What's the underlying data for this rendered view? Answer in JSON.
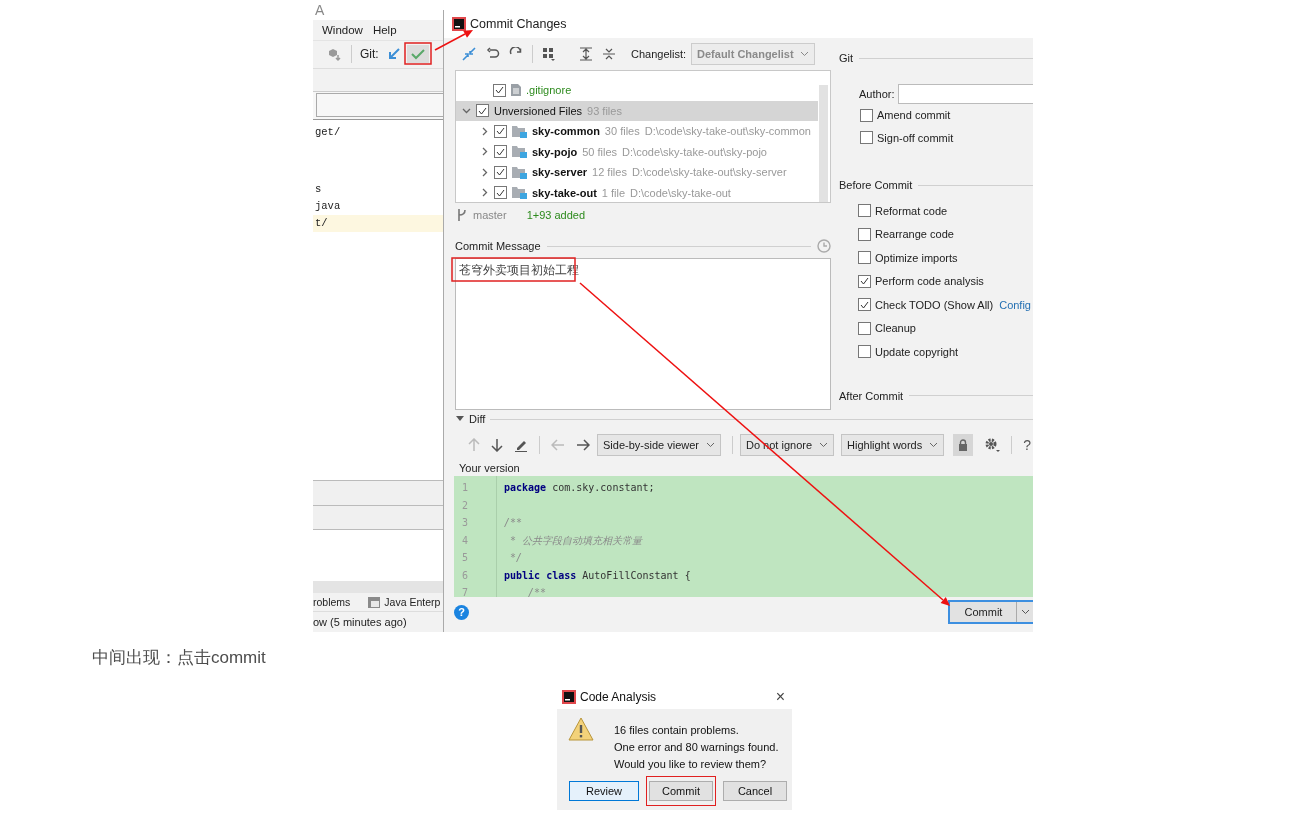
{
  "ide": {
    "title": "A",
    "menu": [
      {
        "label": "Window"
      },
      {
        "label": "Help"
      }
    ],
    "git_label": "Git:",
    "files": [
      {
        "text": "get/",
        "highlighted": false
      },
      {
        "text": "s",
        "highlighted": false
      },
      {
        "text": "java",
        "highlighted": false
      },
      {
        "text": "t/",
        "highlighted": true
      }
    ],
    "tool_tabs": [
      {
        "label": "roblems",
        "kind": "plain"
      },
      {
        "label": "Java Enterp",
        "kind": "icon"
      }
    ],
    "status": "ow (5 minutes ago)"
  },
  "commit_dialog": {
    "title": "Commit Changes",
    "changelist_label": "Changelist:",
    "changelist": {
      "value": "Default Changelist",
      "disabled": true
    },
    "tree": [
      {
        "name": ".gitignore",
        "kind": "file",
        "checked": true,
        "selected": false
      },
      {
        "name": "Unversioned Files",
        "count": "93 files",
        "kind": "group",
        "checked": true,
        "expanded": true,
        "selected": true,
        "children": [
          {
            "name": "sky-common",
            "count": "30 files",
            "path": "D:\\code\\sky-take-out\\sky-common",
            "checked": true,
            "expanded": false,
            "selected": false
          },
          {
            "name": "sky-pojo",
            "count": "50 files",
            "path": "D:\\code\\sky-take-out\\sky-pojo",
            "checked": true,
            "expanded": false,
            "selected": false
          },
          {
            "name": "sky-server",
            "count": "12 files",
            "path": "D:\\code\\sky-take-out\\sky-server",
            "checked": true,
            "expanded": false,
            "selected": false
          },
          {
            "name": "sky-take-out",
            "count": "1 file",
            "path": "D:\\code\\sky-take-out",
            "checked": true,
            "expanded": false,
            "selected": false
          }
        ]
      }
    ],
    "branch": "master",
    "summary": "1+93 added",
    "message_label": "Commit Message",
    "message": "苍穹外卖项目初始工程",
    "git_section": "Git",
    "author_label": "Author:",
    "git_options": [
      {
        "label": "Amend commit",
        "checked": false
      },
      {
        "label": "Sign-off commit",
        "checked": false
      }
    ],
    "before_section": "Before Commit",
    "before_options": [
      {
        "label": "Reformat code",
        "checked": false
      },
      {
        "label": "Rearrange code",
        "checked": false
      },
      {
        "label": "Optimize imports",
        "checked": false
      },
      {
        "label": "Perform code analysis",
        "checked": true
      },
      {
        "label": "Check TODO (Show All)",
        "checked": true,
        "link": "Config"
      },
      {
        "label": "Cleanup",
        "checked": false
      },
      {
        "label": "Update copyright",
        "checked": false
      }
    ],
    "after_section": "After Commit",
    "diff": {
      "label": "Diff",
      "expanded": true,
      "viewer": "Side-by-side viewer",
      "ignore": "Do not ignore",
      "highlight": "Highlight words",
      "help": "?",
      "version_label": "Your version",
      "lines": [
        {
          "number": "1",
          "kind": "code",
          "text": "**package** com.sky.constant;"
        },
        {
          "number": "2"
        },
        {
          "number": "3",
          "kind": "comment",
          "text": "/**"
        },
        {
          "number": "4",
          "kind": "comment",
          "text": " * 公共字段自动填充相关常量"
        },
        {
          "number": "5",
          "kind": "comment",
          "text": " */"
        },
        {
          "number": "6",
          "kind": "code",
          "text": "**public** **class** AutoFillConstant {"
        },
        {
          "number": "7",
          "kind": "comment",
          "text": "    /**"
        }
      ]
    },
    "help": "?",
    "commit_button": "Commit"
  },
  "caption": "中间出现：点击commit",
  "analysis_dialog": {
    "title": "Code Analysis",
    "close": "×",
    "lines": [
      "16 files contain problems.",
      "One error and 80 warnings found.",
      "Would you like to review them?"
    ],
    "buttons": [
      {
        "label": "Review",
        "kind": "default",
        "highlighted": false
      },
      {
        "label": "Commit",
        "kind": "normal",
        "highlighted": true
      },
      {
        "label": "Cancel",
        "kind": "normal",
        "highlighted": false
      }
    ]
  }
}
